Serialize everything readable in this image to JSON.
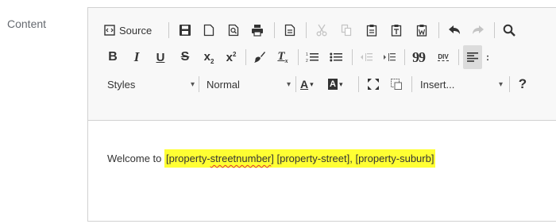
{
  "field": {
    "label": "Content"
  },
  "toolbar": {
    "source_label": "Source",
    "styles_combo": "Styles",
    "format_combo": "Normal",
    "insert_combo": "Insert...",
    "icons": {
      "bold": "B",
      "italic": "I",
      "underline": "U",
      "strike": "S",
      "subscript_base": "x",
      "subscript_mark": "2",
      "superscript_base": "x",
      "superscript_mark": "2",
      "blockquote": "99",
      "help": "?",
      "text_color": "A",
      "bg_color": "A",
      "remove_format": "T",
      "remove_format_sub": "x",
      "creatediv": "DIV"
    }
  },
  "content": {
    "prefix": "Welcome to ",
    "highlight_parts": [
      {
        "text": "[property-",
        "misspelled": false
      },
      {
        "text": "streetnumber",
        "misspelled": true
      },
      {
        "text": "] [property-street], [property-suburb]",
        "misspelled": false
      }
    ]
  },
  "colors": {
    "highlight": "#ffff33",
    "toolbar_bg": "#f8f8f8",
    "border": "#d1d1d1",
    "spellcheck": "#e03030"
  }
}
